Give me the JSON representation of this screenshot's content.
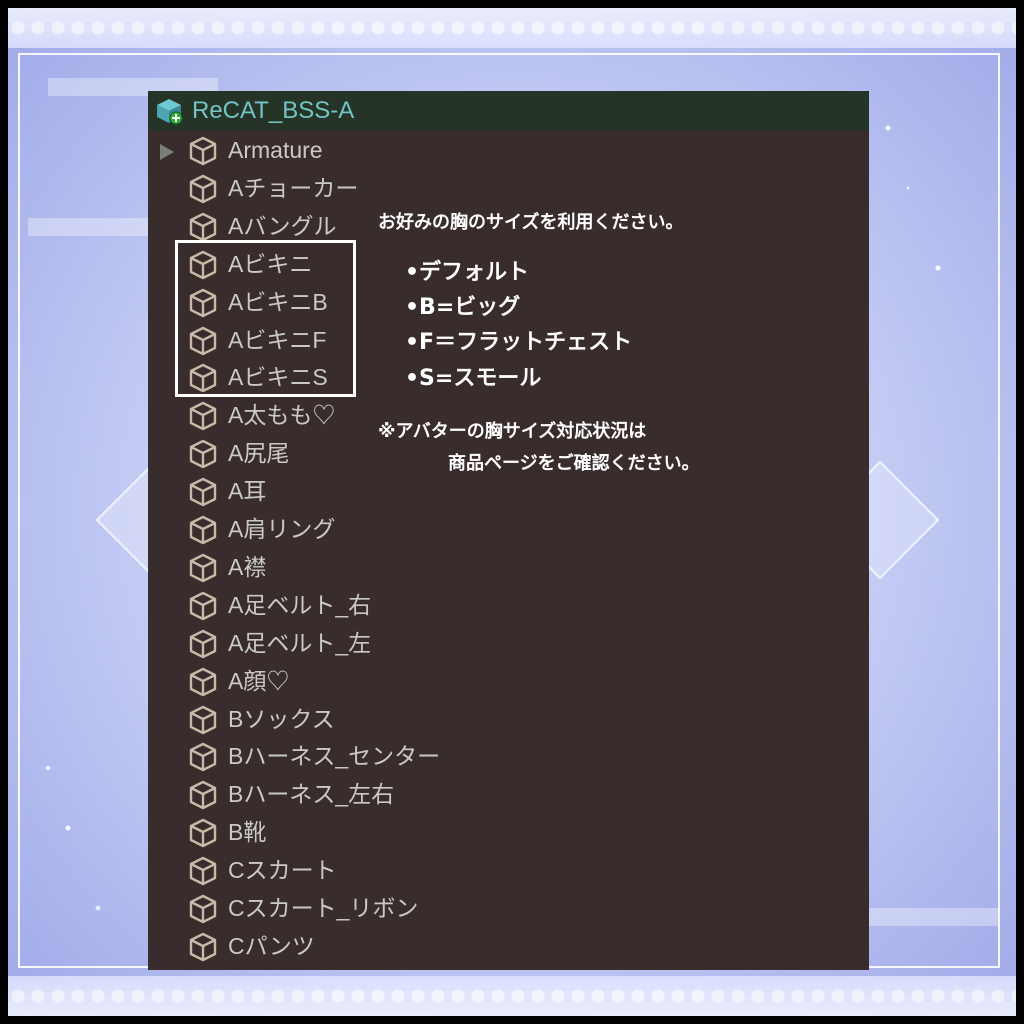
{
  "hierarchy": {
    "root": {
      "label": "ReCAT_BSS-A",
      "icon": "prefab-add-icon"
    },
    "items": [
      {
        "label": "Armature",
        "icon": "cube-icon",
        "expandable": true
      },
      {
        "label": "Aチョーカー",
        "icon": "cube-icon"
      },
      {
        "label": "Aバングル",
        "icon": "cube-icon"
      },
      {
        "label": "Aビキニ",
        "icon": "cube-icon"
      },
      {
        "label": "AビキニB",
        "icon": "cube-icon"
      },
      {
        "label": "AビキニF",
        "icon": "cube-icon"
      },
      {
        "label": "AビキニS",
        "icon": "cube-icon"
      },
      {
        "label": "A太もも♡",
        "icon": "cube-icon"
      },
      {
        "label": "A尻尾",
        "icon": "cube-icon"
      },
      {
        "label": "A耳",
        "icon": "cube-icon"
      },
      {
        "label": "A肩リング",
        "icon": "cube-icon"
      },
      {
        "label": "A襟",
        "icon": "cube-icon"
      },
      {
        "label": "A足ベルト_右",
        "icon": "cube-icon"
      },
      {
        "label": "A足ベルト_左",
        "icon": "cube-icon"
      },
      {
        "label": "A顔♡",
        "icon": "cube-icon"
      },
      {
        "label": "Bソックス",
        "icon": "cube-icon"
      },
      {
        "label": "Bハーネス_センター",
        "icon": "cube-icon"
      },
      {
        "label": "Bハーネス_左右",
        "icon": "cube-icon"
      },
      {
        "label": "B靴",
        "icon": "cube-icon"
      },
      {
        "label": "Cスカート",
        "icon": "cube-icon"
      },
      {
        "label": "Cスカート_リボン",
        "icon": "cube-icon"
      },
      {
        "label": "Cパンツ",
        "icon": "cube-icon"
      }
    ]
  },
  "instructions": {
    "intro": "お好みの胸のサイズを利用ください。",
    "options": [
      "•デフォルト",
      "•B=ビッグ",
      "•F＝フラットチェスト",
      "•S=スモール"
    ],
    "note_line1": "※アバターの胸サイズ対応状況は",
    "note_line2": "商品ページをご確認ください。"
  },
  "colors": {
    "panel_bg": "#382d2c",
    "header_bg": "#263428",
    "root_text": "#73c4c5",
    "item_text": "#c9c9c9",
    "highlight": "#ffffff"
  }
}
